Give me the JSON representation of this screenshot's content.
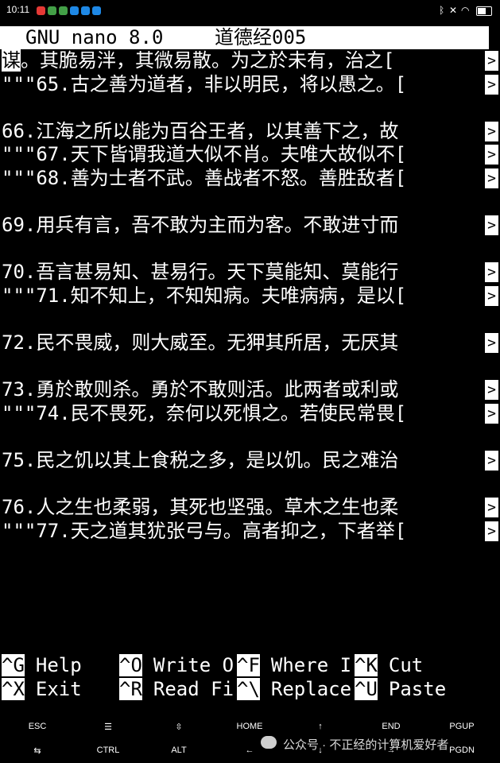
{
  "status_bar": {
    "time": "10:11",
    "app_badge_colors": [
      "#e53935",
      "#43a047",
      "#43a047",
      "#1e88e5",
      "#1e88e5",
      "#1e88e5"
    ],
    "icons": [
      "bluetooth-icon",
      "mute-icon",
      "wifi-icon",
      "battery-icon"
    ],
    "battery_level": 0.7
  },
  "nano": {
    "program": "GNU nano 8.0",
    "filename": "道德经005"
  },
  "editor": {
    "lines": [
      {
        "text": "谋。其脆易泮，其微易散。为之於未有，治之[",
        "overflow": ">",
        "cursor": true
      },
      {
        "text": "\"\"\"65.古之善为道者，非以明民，将以愚之。[",
        "overflow": ">"
      },
      {
        "text": "",
        "overflow": ""
      },
      {
        "text": "66.江海之所以能为百谷王者，以其善下之，故",
        "overflow": ">"
      },
      {
        "text": "\"\"\"67.天下皆谓我道大似不肖。夫唯大故似不[",
        "overflow": ">"
      },
      {
        "text": "\"\"\"68.善为士者不武。善战者不怒。善胜敌者[",
        "overflow": ">"
      },
      {
        "text": "",
        "overflow": ""
      },
      {
        "text": "69.用兵有言，吾不敢为主而为客。不敢进寸而",
        "overflow": ">"
      },
      {
        "text": "",
        "overflow": ""
      },
      {
        "text": "70.吾言甚易知、甚易行。天下莫能知、莫能行",
        "overflow": ">"
      },
      {
        "text": "\"\"\"71.知不知上，不知知病。夫唯病病，是以[",
        "overflow": ">"
      },
      {
        "text": "",
        "overflow": ""
      },
      {
        "text": "72.民不畏威，则大威至。无狎其所居，无厌其",
        "overflow": ">"
      },
      {
        "text": "",
        "overflow": ""
      },
      {
        "text": "73.勇於敢则杀。勇於不敢则活。此两者或利或",
        "overflow": ">"
      },
      {
        "text": "\"\"\"74.民不畏死，奈何以死惧之。若使民常畏[",
        "overflow": ">"
      },
      {
        "text": "",
        "overflow": ""
      },
      {
        "text": "75.民之饥以其上食税之多，是以饥。民之难治",
        "overflow": ">"
      },
      {
        "text": "",
        "overflow": ""
      },
      {
        "text": "76.人之生也柔弱，其死也坚强。草木之生也柔",
        "overflow": ">"
      },
      {
        "text": "\"\"\"77.天之道其犹张弓与。高者抑之，下者举[",
        "overflow": ">"
      }
    ]
  },
  "shortcuts": [
    {
      "key": "^G",
      "label": "Help"
    },
    {
      "key": "^O",
      "label": "Write O"
    },
    {
      "key": "^F",
      "label": "Where I"
    },
    {
      "key": "^K",
      "label": "Cut"
    },
    {
      "key": "^X",
      "label": "Exit"
    },
    {
      "key": "^R",
      "label": "Read Fi"
    },
    {
      "key": "^\\",
      "label": "Replace"
    },
    {
      "key": "^U",
      "label": "Paste"
    }
  ],
  "extra_keys": {
    "row1": [
      "ESC",
      "☰",
      "⇳",
      "HOME",
      "↑",
      "END",
      "PGUP"
    ],
    "row2": [
      "⇆",
      "CTRL",
      "ALT",
      "←",
      "↓",
      "→",
      "PGDN"
    ]
  },
  "watermark": "公众号 · 不正经的计算机爱好者"
}
